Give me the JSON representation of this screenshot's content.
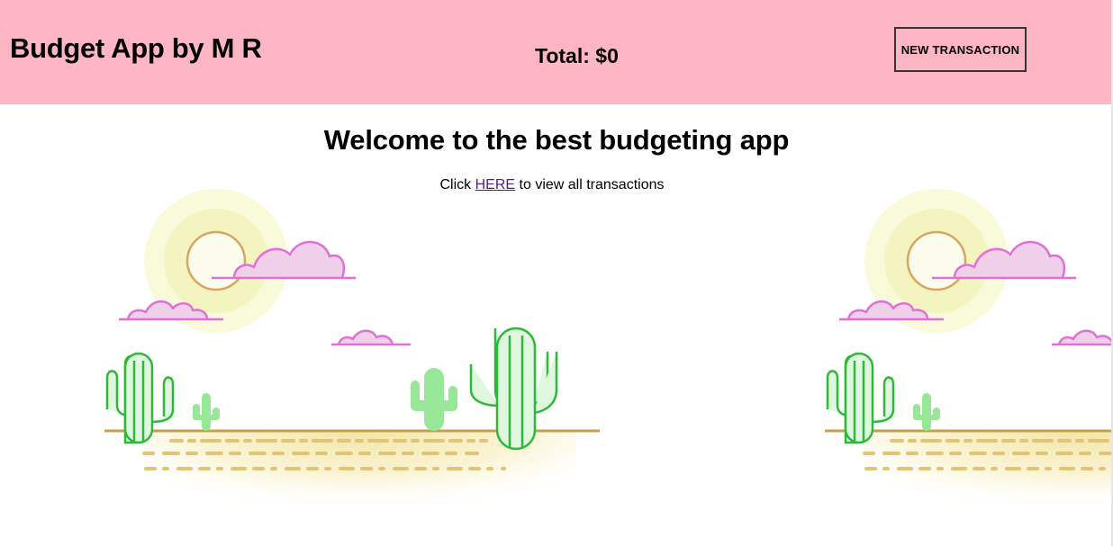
{
  "header": {
    "app_title": "Budget App by M R",
    "total_label": "Total:",
    "total_value": "$0",
    "new_transaction_label": "NEW TRANSACTION"
  },
  "main": {
    "welcome_heading": "Welcome to the best budgeting app",
    "hint_prefix": "Click",
    "hint_link": "HERE",
    "hint_suffix": "to view all transactions"
  },
  "illustration": {
    "description_icon": "desert-cactus-illustration",
    "colors": {
      "header_bg": "#ffb6c4",
      "cloud_fill": "#f0cfe8",
      "cloud_stroke": "#e070d8",
      "cactus_dark": "#2fb83a",
      "cactus_light": "#dff7df",
      "cactus_solid": "#98e698",
      "ground_line": "#c4a04a",
      "sand_dash": "#e2c477",
      "sun_glow": "#f6f8c9",
      "sun_ring": "#d7a561",
      "link": "#551a8b"
    }
  }
}
